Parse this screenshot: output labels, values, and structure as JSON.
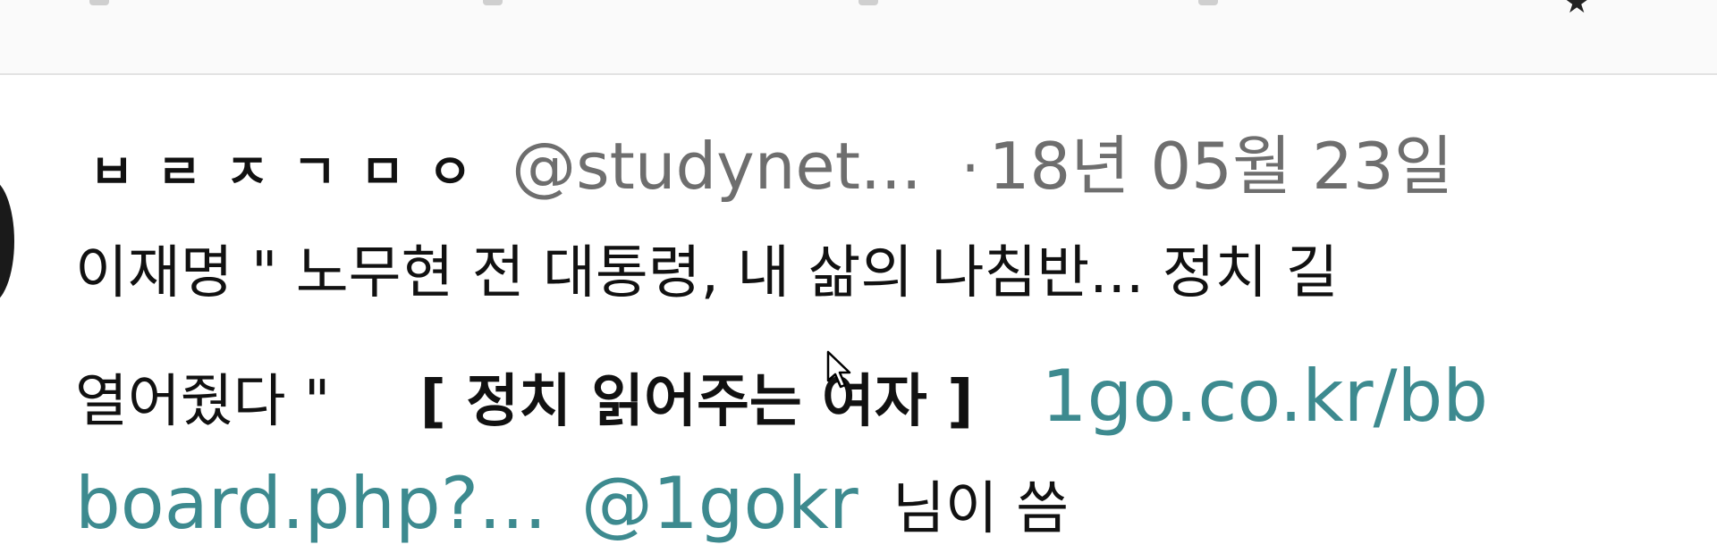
{
  "toolbar": {
    "icons": [
      "reply-icon",
      "retweet-icon",
      "like-icon",
      "stats-icon",
      "bookmark-star-icon"
    ]
  },
  "tweet": {
    "display_name": "ㅂㄹㅈㄱㅁㅇ",
    "handle": "@studynet...",
    "separator": "·",
    "timestamp": "18년 05월 23일",
    "line1": "이재명 \" 노무현 전 대통령, 내 삶의 나침반... 정치 길",
    "line2_text": "열어줬다 \"",
    "line2_bracket": "[ 정치 읽어주는 여자 ]",
    "line2_link": "1go.co.kr/bb",
    "line3_link": "board.php?...",
    "line3_mention": "@1gokr",
    "line3_suffix": "님이 씀"
  },
  "colors": {
    "link": "#3d8a8f",
    "meta": "#6e6e6e",
    "text": "#111111"
  }
}
